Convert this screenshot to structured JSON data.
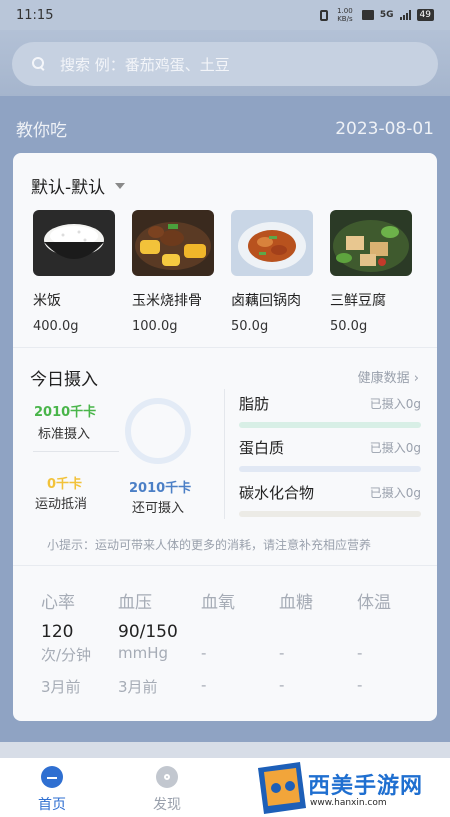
{
  "status_bar": {
    "time": "11:15",
    "net_speed": "1.00 KB/s",
    "network": "5G",
    "battery": "49"
  },
  "search": {
    "placeholder": "搜索 例：番茄鸡蛋、土豆"
  },
  "section": {
    "title": "教你吃",
    "date": "2023-08-01"
  },
  "meal": {
    "selected": "默认-默认"
  },
  "foods": [
    {
      "name": "米饭",
      "weight": "400.0g",
      "icon": "rice-bowl"
    },
    {
      "name": "玉米烧排骨",
      "weight": "100.0g",
      "icon": "corn-ribs-dish"
    },
    {
      "name": "卤藕回锅肉",
      "weight": "50.0g",
      "icon": "pork-lotus-dish"
    },
    {
      "name": "三鲜豆腐",
      "weight": "50.0g",
      "icon": "tofu-dish"
    }
  ],
  "intake": {
    "title": "今日摄入",
    "health_link": "健康数据",
    "standard_value": "2010千卡",
    "standard_label": "标准摄入",
    "exercise_value": "0千卡",
    "exercise_label": "运动抵消",
    "remaining_value": "2010千卡",
    "remaining_label": "还可摄入",
    "consumed_fraction": 0,
    "nutrients": [
      {
        "name": "脂肪",
        "status": "已摄入0g",
        "color": "#d8efe6",
        "fraction": 0
      },
      {
        "name": "蛋白质",
        "status": "已摄入0g",
        "color": "#e1e8f4",
        "fraction": 0
      },
      {
        "name": "碳水化合物",
        "status": "已摄入0g",
        "color": "#ecebe6",
        "fraction": 0
      }
    ],
    "tip": "小提示：运动可带来人体的更多的消耗，请注意补充相应营养"
  },
  "metrics": [
    {
      "label": "心率",
      "value": "120",
      "unit": "次/分钟",
      "time": "3月前"
    },
    {
      "label": "血压",
      "value": "90/150",
      "unit": "mmHg",
      "time": "3月前"
    },
    {
      "label": "血氧",
      "value": "",
      "unit": "-",
      "time": "-"
    },
    {
      "label": "血糖",
      "value": "",
      "unit": "-",
      "time": "-"
    },
    {
      "label": "体温",
      "value": "",
      "unit": "-",
      "time": "-"
    }
  ],
  "tabs": [
    {
      "label": "首页",
      "icon": "home-icon",
      "active": true
    },
    {
      "label": "发现",
      "icon": "compass-icon",
      "active": false
    }
  ],
  "watermark": {
    "text": "西美手游网",
    "url": "www.hanxin.com"
  },
  "colors": {
    "active_tab": "#2f6fd1",
    "inactive_tab": "#9aa1ad",
    "standard_green": "#49b54a",
    "exercise_yellow": "#f2c23a",
    "remaining_blue": "#4b7fc6"
  }
}
